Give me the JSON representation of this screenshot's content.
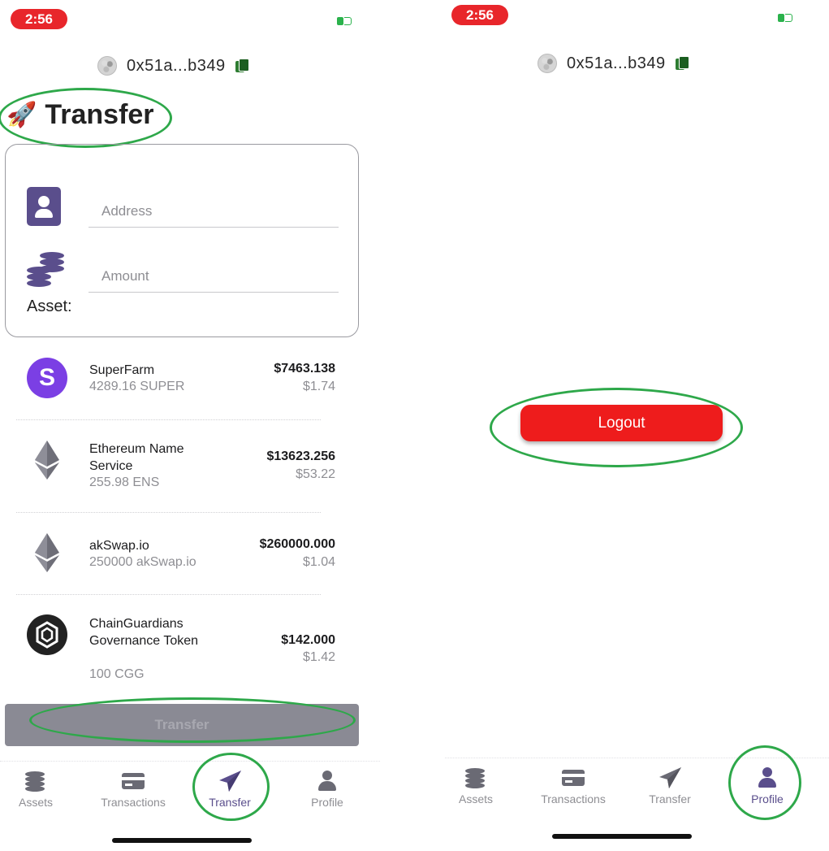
{
  "status_bar": {
    "time": "2:56"
  },
  "account": {
    "address": "0x51a...b349"
  },
  "transfer_screen": {
    "title": "Transfer",
    "title_icon": "rocket-icon",
    "form": {
      "address_placeholder": "Address",
      "amount_placeholder": "Amount",
      "asset_label": "Asset:"
    },
    "tokens": [
      {
        "name": "SuperFarm",
        "balance": "4289.16 SUPER",
        "usd_value": "$7463.138",
        "price": "$1.74",
        "logo": "superfarm-logo"
      },
      {
        "name": "Ethereum Name Service",
        "balance": "255.98 ENS",
        "usd_value": "$13623.256",
        "price": "$53.22",
        "logo": "ethereum-logo"
      },
      {
        "name": "akSwap.io",
        "balance": "250000 akSwap.io",
        "usd_value": "$260000.000",
        "price": "$1.04",
        "logo": "ethereum-logo"
      },
      {
        "name": "ChainGuardians Governance Token",
        "balance": "100 CGG",
        "usd_value": "$142.000",
        "price": "$1.42",
        "logo": "chainguardians-logo"
      }
    ],
    "submit_label": "Transfer"
  },
  "profile_screen": {
    "logout_label": "Logout"
  },
  "tabs": [
    {
      "label": "Assets",
      "icon": "coins-icon"
    },
    {
      "label": "Transactions",
      "icon": "credit-card-icon"
    },
    {
      "label": "Transfer",
      "icon": "paper-plane-icon"
    },
    {
      "label": "Profile",
      "icon": "user-icon"
    }
  ],
  "colors": {
    "accent": "#5a4e8c",
    "logout": "#ee1c1c",
    "highlight_circle": "#2ea84a",
    "time_pill": "#e8262b"
  }
}
